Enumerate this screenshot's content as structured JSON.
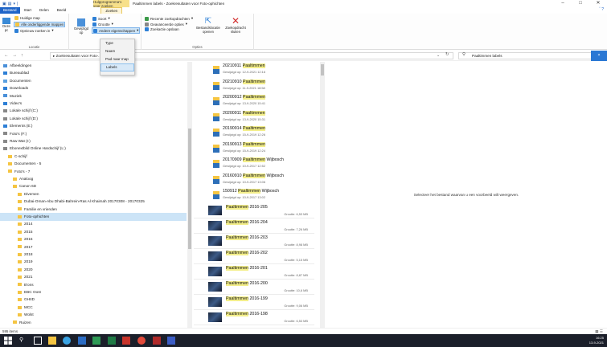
{
  "window": {
    "contextual_tab_header": "Hulpprogramma's voor zoeken",
    "title": "Paaltimmen labels - Zoekresultaten voor Foto-ophichten"
  },
  "tabs": [
    {
      "label": "Bestand"
    },
    {
      "label": "Start"
    },
    {
      "label": "Delen"
    },
    {
      "label": "Beeld"
    },
    {
      "label": "Zoeken"
    }
  ],
  "ribbon": {
    "locatie": {
      "label": "Locatie",
      "deze_pc": "Deze pc",
      "huidige_map": "Huidige map",
      "alle_submappen": "Alle onderliggende mappen",
      "opnieuw_zoeken": "Opnieuw zoeken in"
    },
    "verfijnen": {
      "gewijzigd_op": "Gewijzigd op",
      "soort": "Soort",
      "grootte": "Grootte",
      "andere_eigenschappen": "Andere eigenschappen"
    },
    "opties": {
      "label": "Opties",
      "recente_zoekopdrachten": "Recente zoekopdrachten",
      "geavanceerde_opties": "Geavanceerde opties",
      "zoekactie_opslaan": "Zoekactie opslaan",
      "bestandslocatie_openen": "Bestandslocatie openen",
      "zoekopdracht_sluiten": "Zoekopdracht sluiten"
    }
  },
  "dropdown": {
    "items": [
      {
        "label": "Type"
      },
      {
        "label": "Naam"
      },
      {
        "label": "Pad naar map"
      },
      {
        "label": "Labels"
      }
    ]
  },
  "address": {
    "path": "▸  Zoekresultaten voor Foto-...",
    "search_query": "Paaltimmen labels",
    "back_icon": "←",
    "forward_icon": "→",
    "up_icon": "↑",
    "dropdown_icon": "⌄",
    "refresh_icon": "↻",
    "search_icon": "⚲",
    "clear_icon": "×"
  },
  "navpane": {
    "items": [
      {
        "label": "Afbeeldingen",
        "level": 0
      },
      {
        "label": "Bureaublad",
        "level": 0
      },
      {
        "label": "Documenten",
        "level": 0
      },
      {
        "label": "Downloads",
        "level": 0
      },
      {
        "label": "Muziek",
        "level": 0
      },
      {
        "label": "Video's",
        "level": 0
      },
      {
        "label": "Lokale schijf (C:)",
        "level": 0
      },
      {
        "label": "Lokale schijf (D:)",
        "level": 0
      },
      {
        "label": "Elements (E:)",
        "level": 0
      },
      {
        "label": "Foto's (F:)",
        "level": 0
      },
      {
        "label": "Raw Wat (I:)",
        "level": 0
      },
      {
        "label": "Ebonextbild Online Hardschijf (L:)",
        "level": 0
      },
      {
        "label": "C-schijf",
        "level": 1
      },
      {
        "label": "Documenten - 5",
        "level": 1
      },
      {
        "label": "Foto's - 7",
        "level": 1
      },
      {
        "label": "Analoog",
        "level": 2
      },
      {
        "label": "Canon 6D",
        "level": 2
      },
      {
        "label": "Diversen",
        "level": 3
      },
      {
        "label": "Dubai-Oman-Abu Dhabi-Bahrein-Ras Al Khaimah 20170308 - 20170325",
        "level": 3
      },
      {
        "label": "Familie en vrienden",
        "level": 3
      },
      {
        "label": "Foto-ophichten",
        "level": 3,
        "selected": true
      },
      {
        "label": "2014",
        "level": 3
      },
      {
        "label": "2015",
        "level": 3
      },
      {
        "label": "2016",
        "level": 3
      },
      {
        "label": "2017",
        "level": 3
      },
      {
        "label": "2018",
        "level": 3
      },
      {
        "label": "2019",
        "level": 3
      },
      {
        "label": "2020",
        "level": 3
      },
      {
        "label": "2021",
        "level": 3
      },
      {
        "label": "B'ons",
        "level": 3
      },
      {
        "label": "EBC Oost",
        "level": 3
      },
      {
        "label": "GHIID",
        "level": 3
      },
      {
        "label": "MCC",
        "level": 3
      },
      {
        "label": "Wolst",
        "level": 3
      },
      {
        "label": "Ruizen",
        "level": 2
      }
    ]
  },
  "results": {
    "items": [
      {
        "name_pre": "20210911 ",
        "name_hl": "Paaltimmen",
        "name_post": "",
        "meta": "Gewijzigd op: 12-9-2021 12:16",
        "size": ""
      },
      {
        "name_pre": "20210910 ",
        "name_hl": "Paaltimmen",
        "name_post": "",
        "meta": "Gewijzigd op: 11-9-2021 18:58",
        "size": ""
      },
      {
        "name_pre": "20200912 ",
        "name_hl": "Paaltimmen",
        "name_post": "",
        "meta": "Gewijzigd op: 13-9-2020 15:41",
        "size": ""
      },
      {
        "name_pre": "20200911 ",
        "name_hl": "Paaltimmen",
        "name_post": "",
        "meta": "Gewijzigd op: 13-9-2020 15:31",
        "size": ""
      },
      {
        "name_pre": "20190914 ",
        "name_hl": "Paaltimmen",
        "name_post": "",
        "meta": "Gewijzigd op: 15-9-2019 12:26",
        "size": ""
      },
      {
        "name_pre": "20190913 ",
        "name_hl": "Paaltimmen",
        "name_post": "",
        "meta": "Gewijzigd op: 15-9-2019 12:24",
        "size": ""
      },
      {
        "name_pre": "20170909 ",
        "name_hl": "Paaltimmen",
        "name_post": " Wijbosch",
        "meta": "Gewijzigd op: 10-9-2017 12:52",
        "size": ""
      },
      {
        "name_pre": "20160910 ",
        "name_hl": "Paaltimmen",
        "name_post": " Wijbosch",
        "meta": "Gewijzigd op: 10-9-2017 13:06",
        "size": ""
      },
      {
        "name_pre": "150912 ",
        "name_hl": "Paaltimmen",
        "name_post": " Wijbosch",
        "meta": "Gewijzigd op: 10-9-2017 13:02",
        "size": ""
      },
      {
        "name_pre": "",
        "name_hl": "Paaltimmen",
        "name_post": " 2016-205",
        "meta": "",
        "size": "Grootte: 6,53 MB"
      },
      {
        "name_pre": "",
        "name_hl": "Paaltimmen",
        "name_post": " 2016-204",
        "meta": "",
        "size": "Grootte: 7,26 MB"
      },
      {
        "name_pre": "",
        "name_hl": "Paaltimmen",
        "name_post": " 2016-203",
        "meta": "",
        "size": "Grootte: 8,98 MB"
      },
      {
        "name_pre": "",
        "name_hl": "Paaltimmen",
        "name_post": " 2016-202",
        "meta": "",
        "size": "Grootte: 5,15 MB"
      },
      {
        "name_pre": "",
        "name_hl": "Paaltimmen",
        "name_post": " 2016-201",
        "meta": "",
        "size": "Grootte: 8,87 MB"
      },
      {
        "name_pre": "",
        "name_hl": "Paaltimmen",
        "name_post": " 2016-200",
        "meta": "",
        "size": "Grootte: 10,6 MB"
      },
      {
        "name_pre": "",
        "name_hl": "Paaltimmen",
        "name_post": " 2016-199",
        "meta": "",
        "size": "Grootte: 9,06 MB"
      },
      {
        "name_pre": "",
        "name_hl": "Paaltimmen",
        "name_post": " 2016-198",
        "meta": "",
        "size": "Grootte: 6,53 MB"
      }
    ]
  },
  "preview": {
    "message": "Selecteer het bestand waarvan u een voorbeeld wilt weergeven."
  },
  "status": {
    "count": "595 items"
  },
  "taskbar": {
    "time": "16:25",
    "date": "13-9-2021"
  },
  "colors": {
    "accent": "#1e64c8",
    "highlight": "#f3ee8a",
    "selection": "#cce4f7",
    "taskbar": "#1b1f2a"
  }
}
